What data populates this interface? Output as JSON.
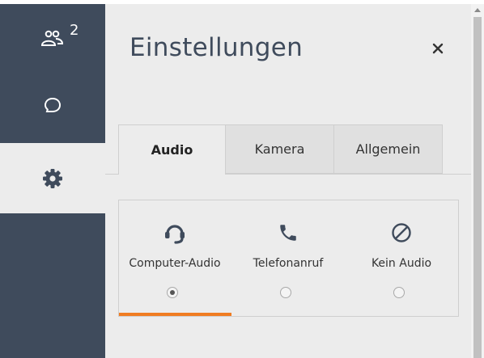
{
  "sidebar": {
    "participants": {
      "icon": "participants-icon",
      "count": "2"
    },
    "chat": {
      "icon": "chat-bubble-icon"
    },
    "settings": {
      "icon": "gear-icon",
      "active": true
    }
  },
  "panel": {
    "title": "Einstellungen",
    "close_icon": "close-icon"
  },
  "tabs": [
    {
      "label": "Audio",
      "active": true
    },
    {
      "label": "Kamera",
      "active": false
    },
    {
      "label": "Allgemein",
      "active": false
    }
  ],
  "audio_options": [
    {
      "label": "Computer-Audio",
      "icon": "headset-icon",
      "selected": true
    },
    {
      "label": "Telefonanruf",
      "icon": "phone-icon",
      "selected": false
    },
    {
      "label": "Kein Audio",
      "icon": "no-audio-icon",
      "selected": false
    }
  ],
  "colors": {
    "sidebar": "#3f4b5c",
    "panel": "#ececec",
    "accent": "#f07c22"
  }
}
